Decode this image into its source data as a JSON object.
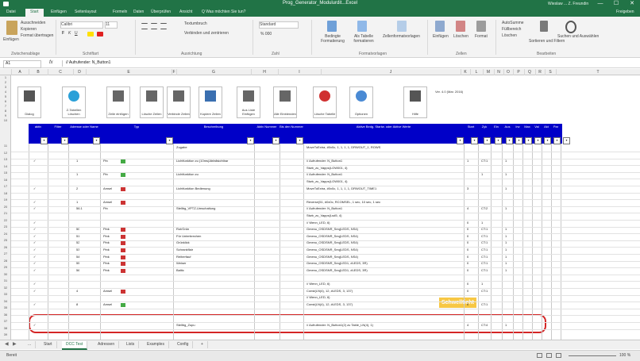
{
  "window": {
    "title": "Prog_Generator_Modulurdit...Excel",
    "account": "Wieslaw ... Z. Freundin",
    "controls": [
      "—",
      "☐",
      "✕"
    ]
  },
  "ribbon_tabs": [
    "Datei",
    "Start",
    "Einfügen",
    "Seitenlayout",
    "Formeln",
    "Daten",
    "Überprüfen",
    "Ansicht",
    "Q Was möchten Sie tun?"
  ],
  "ribbon_tabs_right": "Freigeben",
  "ribbon": {
    "clipboard": {
      "paste": "Einfügen",
      "cut": "Ausschneiden",
      "copy": "Kopieren",
      "format_painter": "Format übertragen",
      "label": "Zwischenablage"
    },
    "font": {
      "name": "Calibri",
      "size": "11",
      "label": "Schriftart"
    },
    "alignment": {
      "wrap": "Textumbruch",
      "merge": "Verbinden und zentrieren",
      "label": "Ausrichtung"
    },
    "number": {
      "format": "Standard",
      "label": "Zahl"
    },
    "styles": {
      "conditional": "Bedingte Formatierung",
      "as_table": "Als Tabelle formatieren",
      "cell_styles": "Zellenformatvorlagen",
      "label": "Formatvorlagen"
    },
    "cells": {
      "insert": "Einfügen",
      "delete": "Löschen",
      "format": "Format",
      "label": "Zellen"
    },
    "editing": {
      "autosum": "AutoSumme",
      "fill": "Füllbereich",
      "clear": "Löschen",
      "sort": "Sortieren und Filtern",
      "find": "Suchen und Auswählen",
      "label": "Bearbeiten"
    }
  },
  "formula_bar": {
    "name_box": "A1",
    "fx": "fx",
    "value": "// Aufrufender: N_Button1"
  },
  "columns": [
    "A",
    "B",
    "C",
    "D",
    "E",
    "F",
    "G",
    "H",
    "I",
    "J",
    "K",
    "L",
    "M",
    "N",
    "O",
    "P",
    "Q",
    "R",
    "S",
    "T"
  ],
  "rows": [
    "1",
    "2",
    "3",
    "4",
    "5",
    "6",
    "7",
    "8",
    "9",
    "10",
    "11",
    "12",
    "13",
    "14",
    "15",
    "16",
    "17",
    "18",
    "19",
    "20",
    "21",
    "22",
    "23",
    "24",
    "25",
    "26",
    "27",
    "28",
    "29",
    "30",
    "31",
    "32",
    "33",
    "34",
    "35",
    "36",
    "37",
    "38",
    "39",
    "40",
    "41",
    "42",
    "43",
    "44",
    "45",
    "46",
    "47"
  ],
  "macro_buttons": [
    {
      "label": "Dialog",
      "icon": "edit-pen-icon"
    },
    {
      "label": "Z-Tabellen Löschen",
      "icon": "infinity-icon"
    },
    {
      "label": "Zeile einfügen",
      "icon": "insert-row-icon"
    },
    {
      "label": "Lösche Zeilen",
      "icon": "delete-row-icon"
    },
    {
      "label": "Verbinde Zeilen",
      "icon": "merge-row-icon"
    },
    {
      "label": "Kopiere Zeilen",
      "icon": "copy-row-icon"
    },
    {
      "label": "Aus Liste Einfügen",
      "icon": "list-insert-icon"
    },
    {
      "label": "Alle Einblenden",
      "icon": "show-all-icon"
    },
    {
      "label": "Lösche Tabelle",
      "icon": "stop-icon"
    },
    {
      "label": "Optionen",
      "icon": "spinner-icon"
    },
    {
      "label": "Hilfe",
      "icon": "help-person-icon"
    }
  ],
  "info_text": "Ver. 4.0 (Mar. 2016)",
  "table_header": [
    {
      "label": "aktiv"
    },
    {
      "label": "Filter"
    },
    {
      "label": "Adresse oder Name"
    },
    {
      "label": "Typ"
    },
    {
      "label": "Beschreibung"
    },
    {
      "label": "Aktiv Nummer"
    },
    {
      "label": "Bis den Nummer"
    },
    {
      "label": "Aktive Bedg. Startw. oder Aktive Werte"
    },
    {
      "label": "Start"
    },
    {
      "label": "Zyk"
    },
    {
      "label": "Ein"
    },
    {
      "label": "Aus"
    },
    {
      "label": "Inv"
    },
    {
      "label": "Max"
    },
    {
      "label": "Val"
    },
    {
      "label": "Akt"
    },
    {
      "label": "Par"
    },
    {
      "label": "Dbl"
    }
  ],
  "data_rows": [
    {
      "a": "",
      "c": "",
      "d": "",
      "sw": "",
      "e": "Zugabe",
      "h": "MoveToExtra, #0x0c, 1, 1, 1, 1, DRWOUT_1, ROWS",
      "n1": "",
      "n2": "",
      "n3": ""
    },
    {
      "a": "",
      "c": "",
      "d": "",
      "sw": "",
      "e": "",
      "h": "",
      "n1": "",
      "n2": "",
      "n3": ""
    },
    {
      "a": "✓",
      "c": "1",
      "d": "Pin",
      "sw": "#44aa44",
      "e": "Lichtfunktion zu (10ms)Abfallsichtbar",
      "h": "// Aufrufender: N_Button1",
      "n1": "1",
      "n2": "CT:1",
      "n3": "1"
    },
    {
      "a": "",
      "c": "",
      "d": "",
      "sw": "",
      "e": "",
      "h": "Stwb_zu_Vapps(LOW001, 4)",
      "n1": "",
      "n2": "",
      "n3": ""
    },
    {
      "a": "",
      "c": "1",
      "d": "Pin",
      "sw": "#44aa44",
      "e": "Lichtfunktion zu",
      "h": "// Aufrufender: N_Button1",
      "n1": "",
      "n2": "1",
      "n3": "1"
    },
    {
      "a": "",
      "c": "",
      "d": "",
      "sw": "",
      "e": "",
      "h": "Stwb_zu_Vapps(LOW001, 4)",
      "n1": "",
      "n2": "",
      "n3": ""
    },
    {
      "a": "✓",
      "c": "2",
      "d": "Amsel",
      "sw": "#cc3333",
      "e": "Lichtfunktion Bedienung",
      "h": "MoveToExtra, #0x0c, 1, 1, 1, 1, DRWOUT_TIME1",
      "n1": "3",
      "n2": "",
      "n3": "1"
    },
    {
      "a": "",
      "c": "",
      "d": "",
      "sw": "",
      "e": "",
      "h": "",
      "n1": "",
      "n2": "",
      "n3": ""
    },
    {
      "a": "✓",
      "c": "1",
      "d": "Amsel",
      "sw": "#cc3333",
      "e": "",
      "h": "Reverse(51, #0x0c, RCOMSEL, 1 sec, 10 sec, 1 sec",
      "n1": "",
      "n2": "",
      "n3": ""
    },
    {
      "a": "✓",
      "c": "56.1",
      "d": "Pin",
      "sw": "",
      "e": "Stellbg_VPTZ-Umschaltung",
      "h": "// Aufrufender: N_Button1",
      "n1": "4",
      "n2": "CT:2",
      "n3": "1"
    },
    {
      "a": "",
      "c": "",
      "d": "",
      "sw": "",
      "e": "",
      "h": "Stwb_zu_Vapps(Lsd5, 4)",
      "n1": "",
      "n2": "",
      "n3": ""
    },
    {
      "a": "✓",
      "c": "",
      "d": "",
      "sw": "",
      "e": "",
      "h": "// Wenn_LED, 6)",
      "n1": "0",
      "n2": "1",
      "n3": ""
    },
    {
      "a": "✓",
      "c": "50",
      "d": "Pink",
      "sw": "#cc3333",
      "e": "Rot/Grün",
      "h": "Gmenu_OSDSNR_Seq(LEDS, NS4)",
      "n1": "0",
      "n2": "CT:1",
      "n3": "1"
    },
    {
      "a": "✓",
      "c": "51",
      "d": "Pink",
      "sw": "#cc3333",
      "e": "Für Unterbrechen",
      "h": "Gmenu_OSDSNR_Seq(LEDS, NS4)",
      "n1": "0",
      "n2": "CT:1",
      "n3": "1"
    },
    {
      "a": "✓",
      "c": "52",
      "d": "Pink",
      "sw": "#cc3333",
      "e": "Grünklick",
      "h": "Gmenu_OSDSNR_Seq(LEDS, NS4)",
      "n1": "0",
      "n2": "CT:1",
      "n3": "1"
    },
    {
      "a": "✓",
      "c": "53",
      "d": "Pink",
      "sw": "#cc3333",
      "e": "Schrankflair",
      "h": "Gmenu_OSDSNR_Seq(LEDS, NS4)",
      "n1": "0",
      "n2": "CT:1",
      "n3": "1"
    },
    {
      "a": "✓",
      "c": "54",
      "d": "Pink",
      "sw": "#cc3333",
      "e": "Reiherfauf",
      "h": "Gmenu_OSDSNR_Seq(LEDS, NS4)",
      "n1": "0",
      "n2": "CT:1",
      "n3": "1"
    },
    {
      "a": "✓",
      "c": "55",
      "d": "Pink",
      "sw": "#cc3333",
      "e": "Weiser",
      "h": "Gmenu_OSDSNR_Seq(LED1, #LEDS, 3R)",
      "n1": "0",
      "n2": "CT:1",
      "n3": "1"
    },
    {
      "a": "✓",
      "c": "56",
      "d": "Pink",
      "sw": "#cc3333",
      "e": "Baltic",
      "h": "Gmenu_OSDSNR_Seq(LED1, #LEDS, 3R)",
      "n1": "0",
      "n2": "CT:1",
      "n3": "1"
    },
    {
      "a": "",
      "c": "",
      "d": "",
      "sw": "",
      "e": "",
      "h": "",
      "n1": "",
      "n2": "",
      "n3": ""
    },
    {
      "a": "✓",
      "c": "",
      "d": "",
      "sw": "",
      "e": "",
      "h": "// Wenn_LED, 6)",
      "n1": "0",
      "n2": "1",
      "n3": ""
    },
    {
      "a": "✓",
      "c": "4",
      "d": "Amsel",
      "sw": "#cc3333",
      "e": "",
      "h": "Const(LN(4), 12, #LEDS, 3, 137)",
      "n1": "0",
      "n2": "CT:1",
      "n3": ""
    },
    {
      "a": "",
      "c": "",
      "d": "",
      "sw": "",
      "e": "",
      "h": "// Wenn_LED, 6)",
      "n1": "",
      "n2": "",
      "n3": ""
    },
    {
      "a": "✓",
      "c": "8",
      "d": "Amsel",
      "sw": "#44aa44",
      "e": "",
      "h": "Const(LN(4), 12, #LEDS, 3, 137)",
      "n1": "0",
      "n2": "CT:1",
      "n3": ""
    },
    {
      "a": "",
      "c": "",
      "d": "",
      "sw": "",
      "e": "",
      "h": "",
      "n1": "",
      "n2": "",
      "n3": ""
    },
    {
      "a": "",
      "c": "",
      "d": "",
      "sw": "",
      "e": "",
      "h": "",
      "n1": "",
      "n2": "",
      "n3": ""
    },
    {
      "a": "✓",
      "c": "",
      "d": "",
      "sw": "",
      "e": "Stellbg_Zupu",
      "h": "// Aufrufender: N_Button1(2) zu Table_LN(4), 1)",
      "n1": "4",
      "n2": "CT:4",
      "n3": "1"
    }
  ],
  "highlight_badge": "Schwellticht",
  "sheet_tabs": [
    "...",
    "Start",
    "DCC Test",
    "Adressen",
    "Lists",
    "Examples",
    "Config",
    "+"
  ],
  "active_sheet": "DCC Test",
  "status": {
    "ready": "Bereit",
    "zoom": "100 %"
  }
}
